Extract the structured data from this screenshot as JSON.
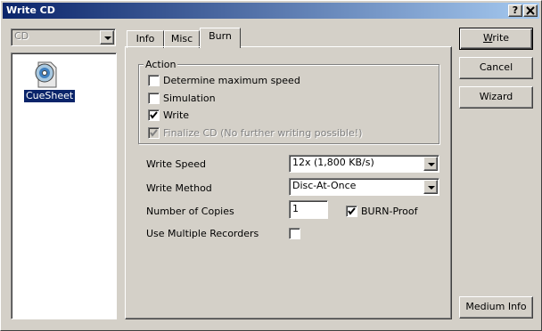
{
  "window": {
    "title": "Write CD",
    "help_label": "?",
    "close_label": "X"
  },
  "left": {
    "drive_select": "CD",
    "item_label": "CueSheet"
  },
  "tabs": [
    {
      "label": "Info"
    },
    {
      "label": "Misc"
    },
    {
      "label": "Burn"
    }
  ],
  "action": {
    "group_label": "Action",
    "options": [
      {
        "label": "Determine maximum speed",
        "checked": false
      },
      {
        "label": "Simulation",
        "checked": false
      },
      {
        "label": "Write",
        "checked": true
      },
      {
        "label": "Finalize CD (No further writing possible!)",
        "checked": true,
        "disabled": true
      }
    ]
  },
  "fields": {
    "write_speed_label": "Write Speed",
    "write_speed_value": "12x (1,800 KB/s)",
    "write_method_label": "Write Method",
    "write_method_value": "Disc-At-Once",
    "copies_label": "Number of Copies",
    "copies_value": "1",
    "burnproof_label": "BURN-Proof",
    "burnproof_checked": true,
    "multi_rec_label": "Use Multiple Recorders",
    "multi_rec_checked": false
  },
  "buttons": {
    "write": "Write",
    "cancel": "Cancel",
    "wizard": "Wizard",
    "medium_info": "Medium Info"
  }
}
